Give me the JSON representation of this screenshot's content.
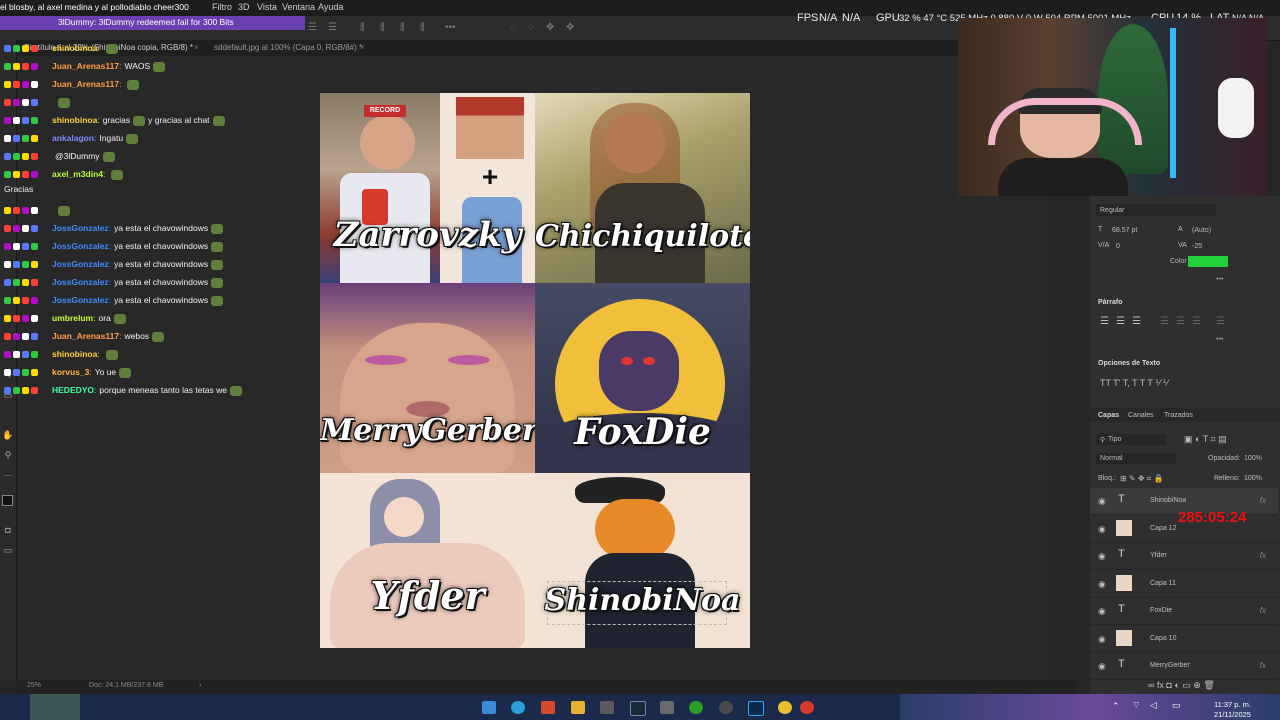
{
  "ticker": "el blosby, al axel medina y al pollodiablo cheer300",
  "bits_banner": "3lDummy: 3lDummy redeemed fail for 300 Bits",
  "menu": [
    "Filtro",
    "3D",
    "Vista",
    "Ventana",
    "Ayuda"
  ],
  "perf": {
    "fps_label": "FPS",
    "fps_val1": "N/A",
    "fps_val2": "N/A",
    "gpu_label": "GPU",
    "gpu_val": "32 % 47 °C 525 MHz 0.880 V 0 W 504 RPM 5001 MHz",
    "cpu_label": "CPU",
    "cpu_val": "14 %",
    "lat_label": "LAT",
    "lat_val": "N/A N/A"
  },
  "tabs": [
    "Sin título-1 al 25% (ShinobiNoa copia, RGB/8) *",
    "sddefault.jpg al 100% (Capa 0, RGB/8#) *"
  ],
  "chat": [
    {
      "user": "shinobinoa",
      "msg": "",
      "color": "#ffd23f"
    },
    {
      "user": "Juan_Arenas117",
      "msg": "WAOS",
      "color": "#ff9f43"
    },
    {
      "user": "Juan_Arenas117",
      "msg": "",
      "color": "#ff9f43"
    },
    {
      "user": "",
      "msg": "",
      "color": "#ff4040"
    },
    {
      "user": "shinobinoa",
      "msg": "gracias",
      "msg2": "y gracias al chat",
      "color": "#ffd23f"
    },
    {
      "user": "ankalagon",
      "msg": "Ingatu",
      "color": "#7f8cff"
    },
    {
      "user": "",
      "msg": "@3lDummy",
      "color": "#ff4040"
    },
    {
      "user": "axel_m3din4",
      "msg": "",
      "color": "#b6ff3f"
    },
    {
      "user": "",
      "msg": "",
      "color": "#ffffff"
    },
    {
      "user": "JossGonzalez",
      "msg": "ya esta el chavowindows",
      "color": "#3f8cff"
    },
    {
      "user": "JossGonzalez",
      "msg": "ya esta el chavowindows",
      "color": "#3f8cff"
    },
    {
      "user": "JossGonzalez",
      "msg": "ya esta el chavowindows",
      "color": "#3f8cff"
    },
    {
      "user": "JossGonzalez",
      "msg": "ya esta el chavowindows",
      "color": "#3f8cff"
    },
    {
      "user": "JossGonzalez",
      "msg": "ya esta el chavowindows",
      "color": "#3f8cff"
    },
    {
      "user": "umbrelum",
      "msg": "ora",
      "color": "#c6ff3f"
    },
    {
      "user": "Juan_Arenas117",
      "msg": "webos",
      "color": "#ff9f43"
    },
    {
      "user": "shinobinoa",
      "msg": "",
      "color": "#ffd23f"
    },
    {
      "user": "korvus_3",
      "msg": "Yo ue",
      "color": "#ffb347"
    },
    {
      "user": "HEDEDYO",
      "msg": "porque meneas tanto las tetas we",
      "color": "#3fffa0"
    }
  ],
  "chat_gracias": "Gracias",
  "document": {
    "names": [
      "Zarrovzky",
      "Chichiquilote",
      "MerryGerber",
      "FoxDie",
      "Yfder",
      "ShinobiNoa"
    ],
    "record_label": "RECORD",
    "plus": "+"
  },
  "properties": {
    "style": "Regular",
    "size": "68.57 pt",
    "leading": "(Auto)",
    "tracking_left": "0",
    "tracking_right": "-25",
    "color_label": "Color",
    "color_swatch": "#22d13a",
    "paragraph_title": "Párrafo",
    "text_options_title": "Opciones de Texto"
  },
  "layers_panel": {
    "tabs": [
      "Capas",
      "Canales",
      "Trazados"
    ],
    "filter": "Tipo",
    "blend": "Normal",
    "opacity_label": "Opacidad:",
    "opacity_val": "100%",
    "lock_label": "Bloq.:",
    "fill_label": "Relleno:",
    "fill_val": "100%",
    "layers": [
      {
        "name": "ShinobiNoa",
        "kind": "text"
      },
      {
        "name": "Capa 12",
        "kind": "image"
      },
      {
        "name": "Yfder",
        "kind": "text"
      },
      {
        "name": "Capa 11",
        "kind": "image"
      },
      {
        "name": "FoxDie",
        "kind": "text"
      },
      {
        "name": "Capa 10",
        "kind": "image"
      },
      {
        "name": "MerryGerber",
        "kind": "text"
      }
    ]
  },
  "timer": "285:05:24",
  "status": {
    "zoom": "25%",
    "doc": "Doc: 24.1 MB/237.8 MB"
  },
  "clock": {
    "time": "11:37 p. m.",
    "date": "21/11/2025"
  },
  "icons": [
    "windows-icon",
    "edge-icon",
    "store-icon",
    "folder-icon",
    "steam-icon",
    "xbox-icon",
    "photoshop-icon",
    "chrome-icon"
  ]
}
